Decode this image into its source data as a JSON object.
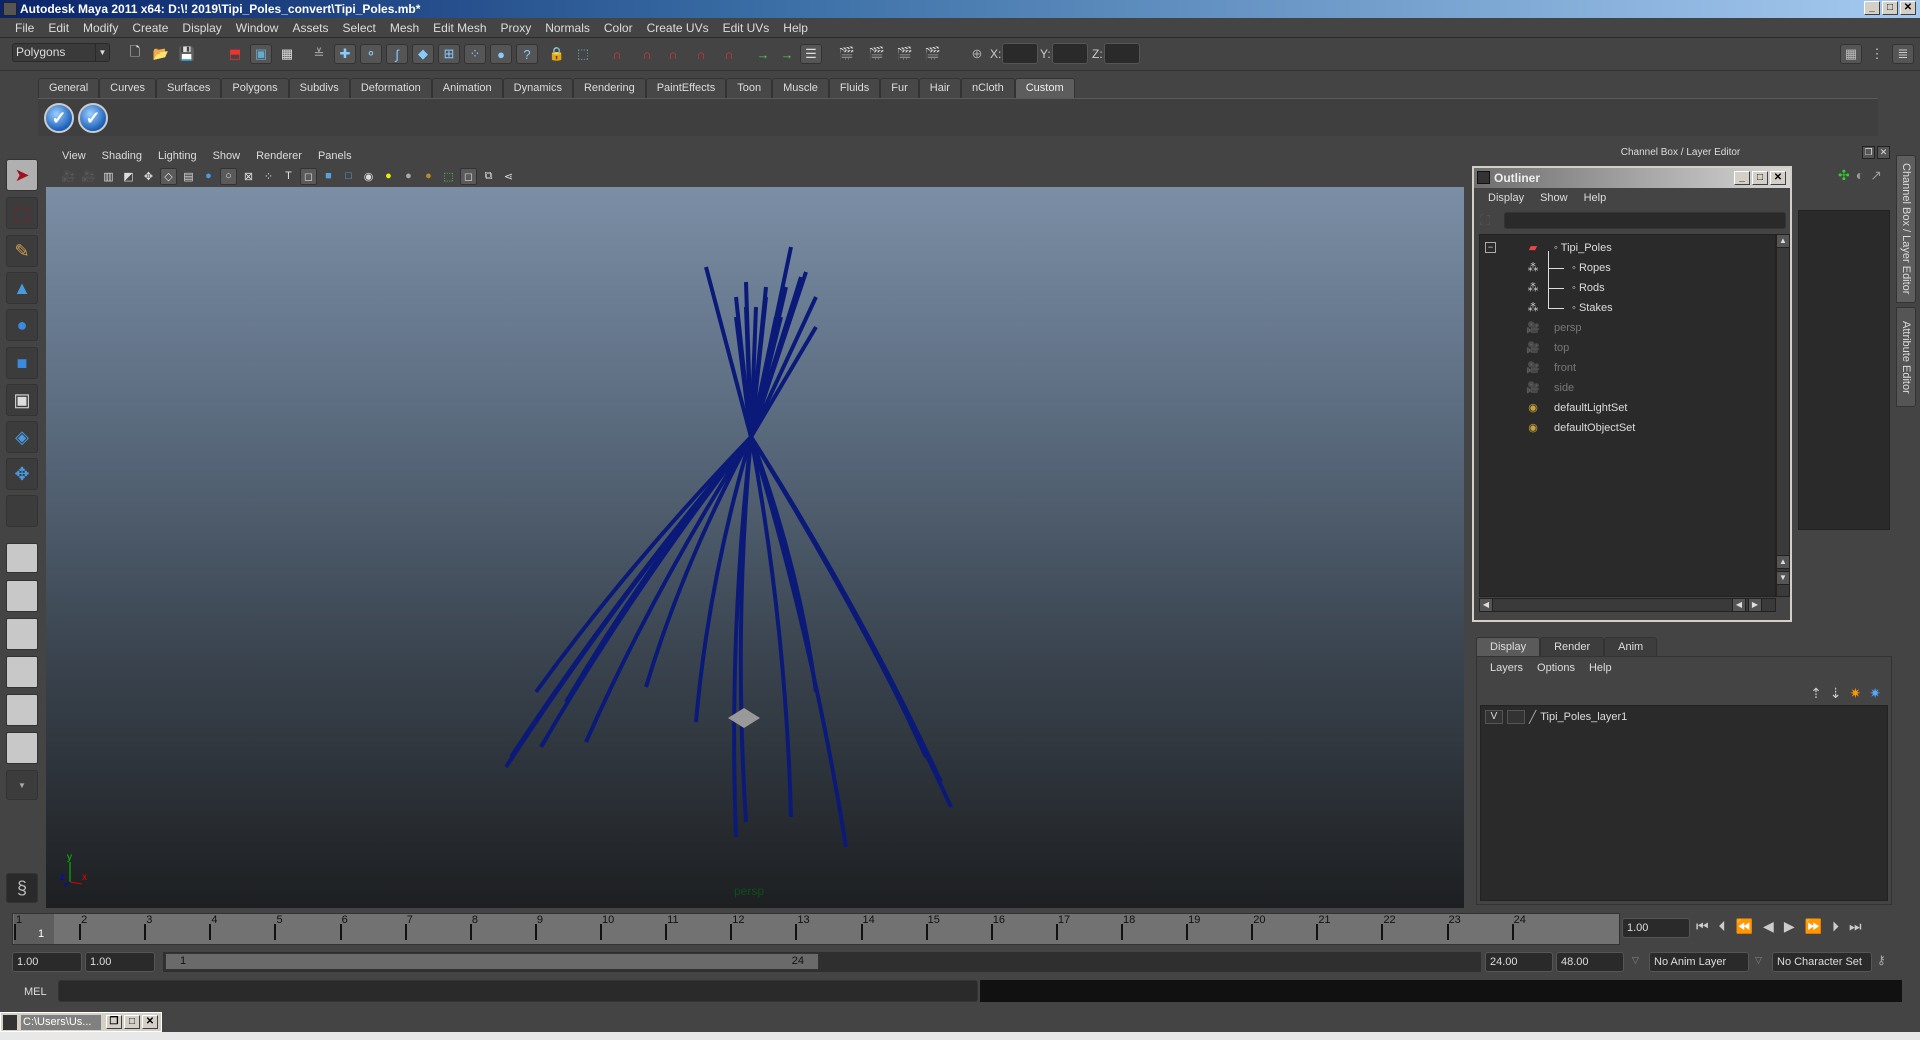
{
  "window": {
    "title": "Autodesk Maya 2011 x64: D:\\! 2019\\Tipi_Poles_convert\\Tipi_Poles.mb*",
    "controls": [
      "minimize",
      "maximize",
      "close"
    ]
  },
  "menubar": [
    "File",
    "Edit",
    "Modify",
    "Create",
    "Display",
    "Window",
    "Assets",
    "Select",
    "Mesh",
    "Edit Mesh",
    "Proxy",
    "Normals",
    "Color",
    "Create UVs",
    "Edit UVs",
    "Help"
  ],
  "statusline": {
    "mode": "Polygons",
    "coords": {
      "x_label": "X:",
      "y_label": "Y:",
      "z_label": "Z:",
      "x": "",
      "y": "",
      "z": ""
    }
  },
  "shelf": {
    "tabs": [
      "General",
      "Curves",
      "Surfaces",
      "Polygons",
      "Subdivs",
      "Deformation",
      "Animation",
      "Dynamics",
      "Rendering",
      "PaintEffects",
      "Toon",
      "Muscle",
      "Fluids",
      "Fur",
      "Hair",
      "nCloth",
      "Custom"
    ],
    "active_tab": "Custom",
    "buttons": [
      "check-icon",
      "check-icon"
    ]
  },
  "toolbox": [
    "select-tool",
    "lasso-tool",
    "paint-select-tool",
    "move-tool",
    "rotate-tool",
    "scale-tool",
    "universal-manipulator",
    "soft-mod-tool",
    "show-manipulator",
    "last-tool"
  ],
  "viewport": {
    "menu": [
      "View",
      "Shading",
      "Lighting",
      "Show",
      "Renderer",
      "Panels"
    ],
    "camera_label": "persp",
    "axis": {
      "x": "x",
      "y": "y",
      "z": "z"
    },
    "wire_color": "#0b1a78"
  },
  "dock": {
    "title": "Channel Box / Layer Editor",
    "side_tabs": [
      "Channel Box / Layer Editor",
      "Attribute Editor"
    ]
  },
  "outliner": {
    "title": "Outliner",
    "menu": [
      "Display",
      "Show",
      "Help"
    ],
    "filter": "",
    "items": [
      {
        "label": "Tipi_Poles",
        "icon": "transform-icon",
        "indent": 0,
        "dim": false,
        "expanded": true
      },
      {
        "label": "Ropes",
        "icon": "mesh-icon",
        "indent": 1,
        "dim": false
      },
      {
        "label": "Rods",
        "icon": "mesh-icon",
        "indent": 1,
        "dim": false
      },
      {
        "label": "Stakes",
        "icon": "mesh-icon",
        "indent": 1,
        "dim": false
      },
      {
        "label": "persp",
        "icon": "camera-icon",
        "indent": 0,
        "dim": true
      },
      {
        "label": "top",
        "icon": "camera-icon",
        "indent": 0,
        "dim": true
      },
      {
        "label": "front",
        "icon": "camera-icon",
        "indent": 0,
        "dim": true
      },
      {
        "label": "side",
        "icon": "camera-icon",
        "indent": 0,
        "dim": true
      },
      {
        "label": "defaultLightSet",
        "icon": "set-icon",
        "indent": 0,
        "dim": false
      },
      {
        "label": "defaultObjectSet",
        "icon": "set-icon",
        "indent": 0,
        "dim": false
      }
    ]
  },
  "layer_editor": {
    "tabs": [
      "Display",
      "Render",
      "Anim"
    ],
    "active_tab": "Display",
    "menu": [
      "Layers",
      "Options",
      "Help"
    ],
    "layers": [
      {
        "visible": "V",
        "name": "Tipi_Poles_layer1"
      }
    ]
  },
  "timeline": {
    "ticks": [
      "1",
      "2",
      "3",
      "4",
      "5",
      "6",
      "7",
      "8",
      "9",
      "10",
      "11",
      "12",
      "13",
      "14",
      "15",
      "16",
      "17",
      "18",
      "19",
      "20",
      "21",
      "22",
      "23",
      "24"
    ],
    "current_frame_marker": "1",
    "current_time": "1.00"
  },
  "range": {
    "start": "1.00",
    "anim_start": "1.00",
    "slider_min": "1",
    "slider_max": "24",
    "end": "24.00",
    "anim_end": "48.00",
    "anim_layer": "No Anim Layer",
    "character_set": "No Character Set"
  },
  "command_line": {
    "label": "MEL",
    "value": ""
  },
  "taskbar": {
    "label": "C:\\Users\\Us..."
  }
}
